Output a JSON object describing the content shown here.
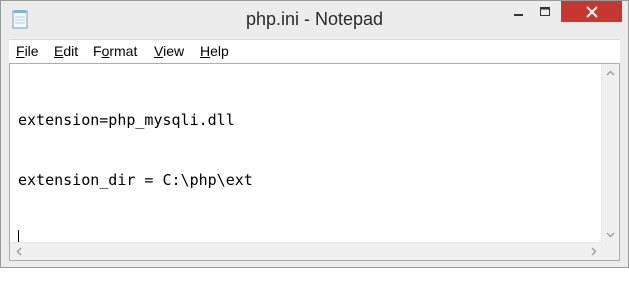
{
  "window": {
    "title": "php.ini - Notepad",
    "icons": {
      "app": "notepad-icon",
      "minimize": "minimize-icon",
      "maximize": "maximize-icon",
      "close": "close-icon"
    },
    "close_button_color": "#c7372f"
  },
  "menu": {
    "items": [
      {
        "label": "File",
        "mnemonic": "F",
        "rest": "ile"
      },
      {
        "label": "Edit",
        "mnemonic": "E",
        "rest": "dit"
      },
      {
        "label": "Format",
        "mnemonic": "o",
        "before": "F",
        "rest": "rmat"
      },
      {
        "label": "View",
        "mnemonic": "V",
        "rest": "iew"
      },
      {
        "label": "Help",
        "mnemonic": "H",
        "rest": "elp"
      }
    ]
  },
  "editor": {
    "lines": [
      "extension=php_mysqli.dll",
      "extension_dir = C:\\php\\ext",
      ""
    ],
    "scrollbars": {
      "vertical": [
        "chevron-up-icon",
        "chevron-down-icon"
      ],
      "horizontal": [
        "chevron-left-icon",
        "chevron-right-icon"
      ]
    }
  }
}
